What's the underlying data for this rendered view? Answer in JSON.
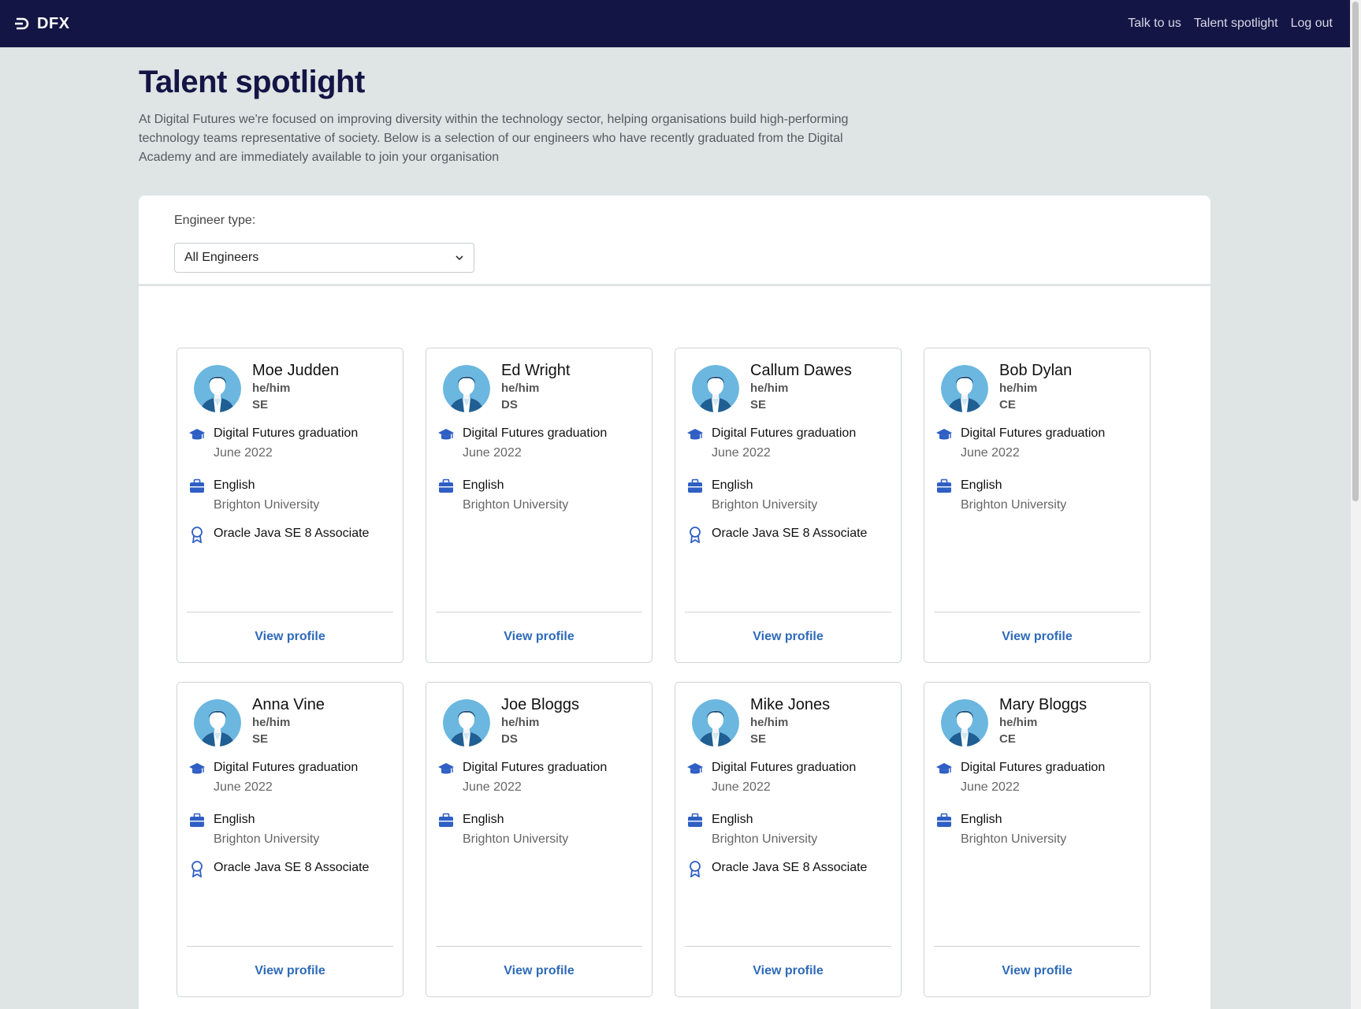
{
  "nav": {
    "brand": "DFX",
    "links": [
      "Talk to us",
      "Talent spotlight",
      "Log out"
    ]
  },
  "header": {
    "title": "Talent spotlight",
    "intro": "At Digital Futures we're focused on improving diversity within the technology sector, helping organisations build high-performing technology teams representative of society. Below is a selection of our engineers who have recently graduated from the Digital Academy and are immediately available to join your organisation"
  },
  "filter": {
    "label": "Engineer type:",
    "selected": "All Engineers"
  },
  "cards": [
    {
      "name": "Moe Judden",
      "pronouns": "he/him",
      "type": "SE",
      "grad_title": "Digital Futures graduation",
      "grad_date": "June 2022",
      "degree": "English",
      "university": "Brighton University",
      "cert": "Oracle Java SE 8 Associate",
      "link": "View profile"
    },
    {
      "name": "Ed Wright",
      "pronouns": "he/him",
      "type": "DS",
      "grad_title": "Digital Futures graduation",
      "grad_date": "June 2022",
      "degree": "English",
      "university": "Brighton University",
      "cert": "",
      "link": "View profile"
    },
    {
      "name": "Callum Dawes",
      "pronouns": "he/him",
      "type": "SE",
      "grad_title": "Digital Futures graduation",
      "grad_date": "June 2022",
      "degree": "English",
      "university": "Brighton University",
      "cert": "Oracle Java SE 8 Associate",
      "link": "View profile"
    },
    {
      "name": "Bob Dylan",
      "pronouns": "he/him",
      "type": "CE",
      "grad_title": "Digital Futures graduation",
      "grad_date": "June 2022",
      "degree": "English",
      "university": "Brighton University",
      "cert": "",
      "link": "View profile"
    },
    {
      "name": "Anna Vine",
      "pronouns": "he/him",
      "type": "SE",
      "grad_title": "Digital Futures graduation",
      "grad_date": "June 2022",
      "degree": "English",
      "university": "Brighton University",
      "cert": "Oracle Java SE 8 Associate",
      "link": "View profile"
    },
    {
      "name": "Joe Bloggs",
      "pronouns": "he/him",
      "type": "DS",
      "grad_title": "Digital Futures graduation",
      "grad_date": "June 2022",
      "degree": "English",
      "university": "Brighton University",
      "cert": "",
      "link": "View profile"
    },
    {
      "name": "Mike Jones",
      "pronouns": "he/him",
      "type": "SE",
      "grad_title": "Digital Futures graduation",
      "grad_date": "June 2022",
      "degree": "English",
      "university": "Brighton University",
      "cert": "Oracle Java SE 8 Associate",
      "link": "View profile"
    },
    {
      "name": "Mary Bloggs",
      "pronouns": "he/him",
      "type": "CE",
      "grad_title": "Digital Futures graduation",
      "grad_date": "June 2022",
      "degree": "English",
      "university": "Brighton University",
      "cert": "",
      "link": "View profile"
    }
  ],
  "icons": {
    "grad": "graduation-cap-icon",
    "lang": "briefcase-icon",
    "cert": "award-icon",
    "avatar": "user-avatar-icon"
  },
  "colors": {
    "navbar": "#131545",
    "accent": "#2e6ab8",
    "icon_blue": "#2f5fc4",
    "avatar_bg": "#6bb7e0"
  }
}
